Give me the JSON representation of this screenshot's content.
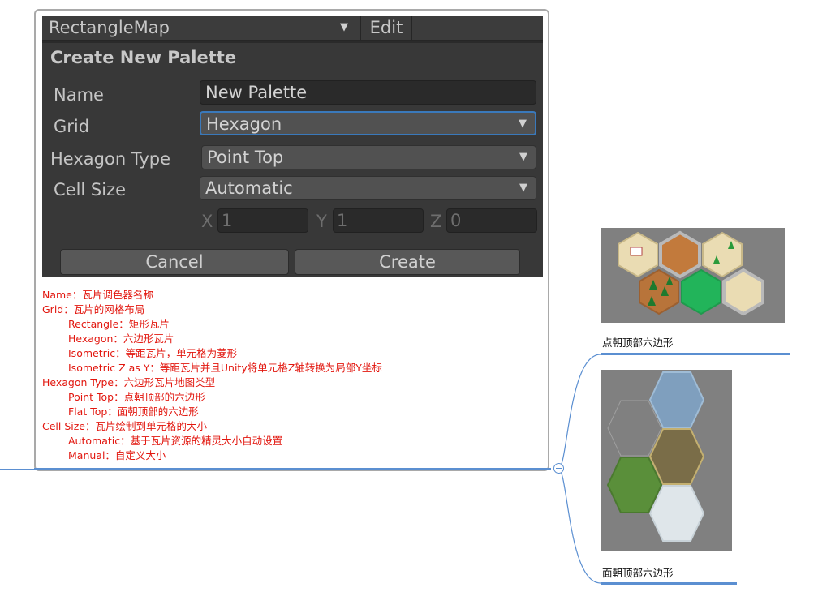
{
  "unity": {
    "map_name": "RectangleMap",
    "edit_label": "Edit",
    "panel_title": "Create New Palette",
    "fields": {
      "name_label": "Name",
      "name_value": "New Palette",
      "grid_label": "Grid",
      "grid_value": "Hexagon",
      "hex_type_label": "Hexagon Type",
      "hex_type_value": "Point Top",
      "cell_size_label": "Cell Size",
      "cell_size_value": "Automatic"
    },
    "cell_vector": {
      "x_label": "X",
      "x_value": "1",
      "y_label": "Y",
      "y_value": "1",
      "z_label": "Z",
      "z_value": "0"
    },
    "cancel_label": "Cancel",
    "create_label": "Create"
  },
  "notes": [
    {
      "text": "Name：瓦片调色器名称",
      "indent": false
    },
    {
      "text": "Grid：瓦片的网格布局",
      "indent": false
    },
    {
      "text": "Rectangle：矩形瓦片",
      "indent": true
    },
    {
      "text": "Hexagon：六边形瓦片",
      "indent": true
    },
    {
      "text": "Isometric：等距瓦片，单元格为菱形",
      "indent": true
    },
    {
      "text": "Isometric Z as Y：等距瓦片并且Unity将单元格Z轴转换为局部Y坐标",
      "indent": true
    },
    {
      "text": "Hexagon Type：六边形瓦片地图类型",
      "indent": false
    },
    {
      "text": "Point Top：点朝顶部的六边形",
      "indent": true
    },
    {
      "text": "Flat Top：面朝顶部的六边形",
      "indent": true
    },
    {
      "text": "Cell Size：瓦片绘制到单元格的大小",
      "indent": false
    },
    {
      "text": "Automatic：基于瓦片资源的精灵大小自动设置",
      "indent": true
    },
    {
      "text": "Manual：自定义大小",
      "indent": true
    }
  ],
  "branches": {
    "top_caption": "点朝顶部六边形",
    "bottom_caption": "面朝顶部六边形"
  },
  "colors": {
    "accent": "#5b8fd1",
    "note_red": "#e2170f",
    "unity_bg": "#383838",
    "focus_blue": "#3a79bb"
  }
}
